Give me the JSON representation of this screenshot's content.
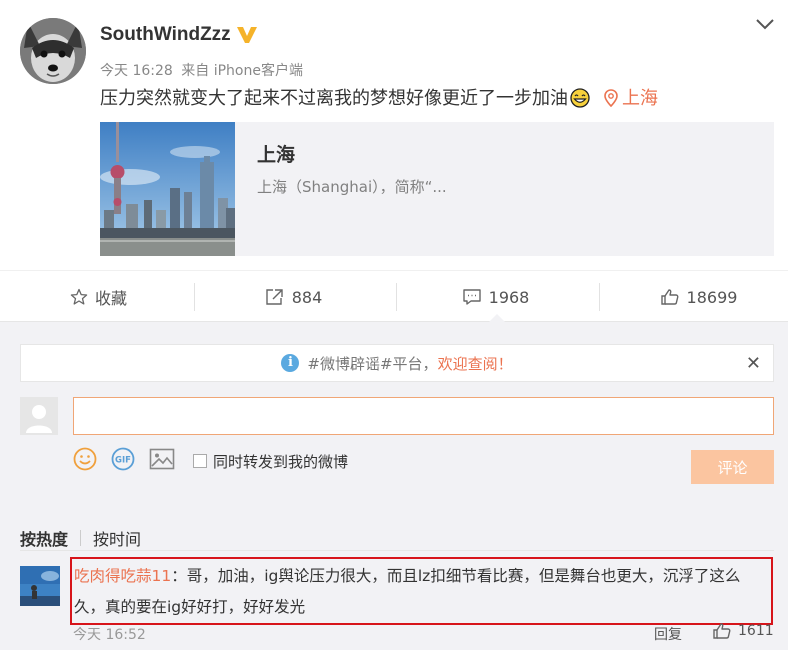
{
  "post": {
    "username": "SouthWindZzz",
    "time": "今天 16:28",
    "source_prefix": "来自",
    "source": "iPhone客户端",
    "text": "压力突然就变大了起来不过离我的梦想好像更近了一步加油",
    "location": "上海",
    "card": {
      "title": "上海",
      "description": "上海（Shanghai），简称“..."
    }
  },
  "actions": {
    "favorite": "收藏",
    "repost_count": "884",
    "comment_count": "1968",
    "like_count": "18699"
  },
  "notice": {
    "text": "#微博辟谣#平台，",
    "link": "欢迎查阅！"
  },
  "composer": {
    "input_value": "",
    "forward_label": "同时转发到我的微博",
    "submit_label": "评论"
  },
  "sort": {
    "hot": "按热度",
    "time": "按时间"
  },
  "comment": {
    "user": "吃肉得吃蒜11",
    "text": "：哥，加油，ig舆论压力很大，而且lz扣细节看比赛，但是舞台也更大，沉浮了这么久，真的要在ig好好打，好好发光",
    "time": "今天 16:52",
    "reply_label": "回复",
    "like_count": "1611"
  },
  "colors": {
    "accent": "#eb7350",
    "highlight_border": "#d7141a",
    "submit_disabled": "#fbc5a0",
    "verified_badge": "#f5b32a",
    "background": "#f2f2f5"
  },
  "icons": [
    "verified-v-icon",
    "chevron-down-icon",
    "grin-emoji-icon",
    "location-pin-icon",
    "star-icon",
    "repost-icon",
    "comment-icon",
    "thumbs-up-icon",
    "info-icon",
    "close-icon",
    "smiley-icon",
    "gif-icon",
    "image-icon"
  ]
}
